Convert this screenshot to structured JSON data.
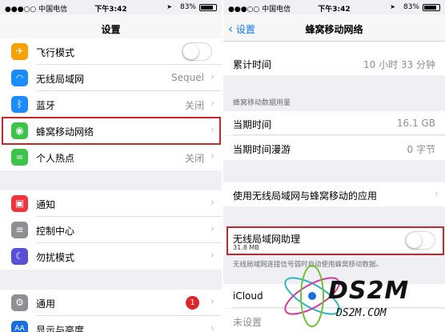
{
  "left": {
    "status": {
      "carrier": "●●●○○ 中国电信 ",
      "time": "下午3:42",
      "battery": "83%"
    },
    "nav_title": "设置",
    "rows_group1": [
      {
        "label": "飞行模式",
        "icon": "airplane-icon",
        "icon_color": "#f7a100",
        "glyph": "✈",
        "toggle": true
      },
      {
        "label": "无线局域网",
        "icon": "wifi-icon",
        "icon_color": "#1a8cff",
        "glyph": "≋",
        "value": "Sequel"
      },
      {
        "label": "蓝牙",
        "icon": "bluetooth-icon",
        "icon_color": "#1a8cff",
        "glyph": "ᛒ",
        "value": "关闭"
      },
      {
        "label": "蜂窝移动网络",
        "icon": "cellular-icon",
        "icon_color": "#3cc34a",
        "glyph": "◉",
        "value": ""
      },
      {
        "label": "个人热点",
        "icon": "hotspot-icon",
        "icon_color": "#3cc34a",
        "glyph": "∞",
        "value": "关闭"
      }
    ],
    "rows_group2": [
      {
        "label": "通知",
        "icon": "notifications-icon",
        "icon_color": "#f0343e",
        "glyph": "▣"
      },
      {
        "label": "控制中心",
        "icon": "control-center-icon",
        "icon_color": "#8e8e93",
        "glyph": "≡"
      },
      {
        "label": "勿扰模式",
        "icon": "do-not-disturb-icon",
        "icon_color": "#5a4fd6",
        "glyph": "☾"
      }
    ],
    "rows_group3": [
      {
        "label": "通用",
        "icon": "general-icon",
        "icon_color": "#8e8e93",
        "glyph": "⚙",
        "badge": "1"
      },
      {
        "label": "显示与亮度",
        "icon": "display-icon",
        "icon_color": "#1a6fe0",
        "glyph": "AA"
      }
    ]
  },
  "right": {
    "status": {
      "carrier": "●●●○○ 中国电信 ",
      "time": "下午3:42",
      "battery": "83%"
    },
    "back_label": "设置",
    "nav_title": "蜂窝移动网络",
    "top_row": {
      "label": "累计时间",
      "value": "10 小时 33 分钟"
    },
    "section_usage": "蜂窝移动数据用量",
    "usage_rows": [
      {
        "label": "当期时间",
        "value": "16.1 GB"
      },
      {
        "label": "当期时间漫游",
        "value": "0 字节"
      }
    ],
    "apps_row": "使用无线局域网与蜂窝移动的应用",
    "assist": {
      "label": "无线局域网助理",
      "sub": "31.8 MB",
      "note": "无线局域网连接信号弱时自动使用蜂窝移动数据。"
    },
    "icloud_row": "iCloud",
    "bottom_partial": "未设置"
  },
  "watermark": {
    "main": "DS2M",
    "sub": "DS2M.COM"
  }
}
